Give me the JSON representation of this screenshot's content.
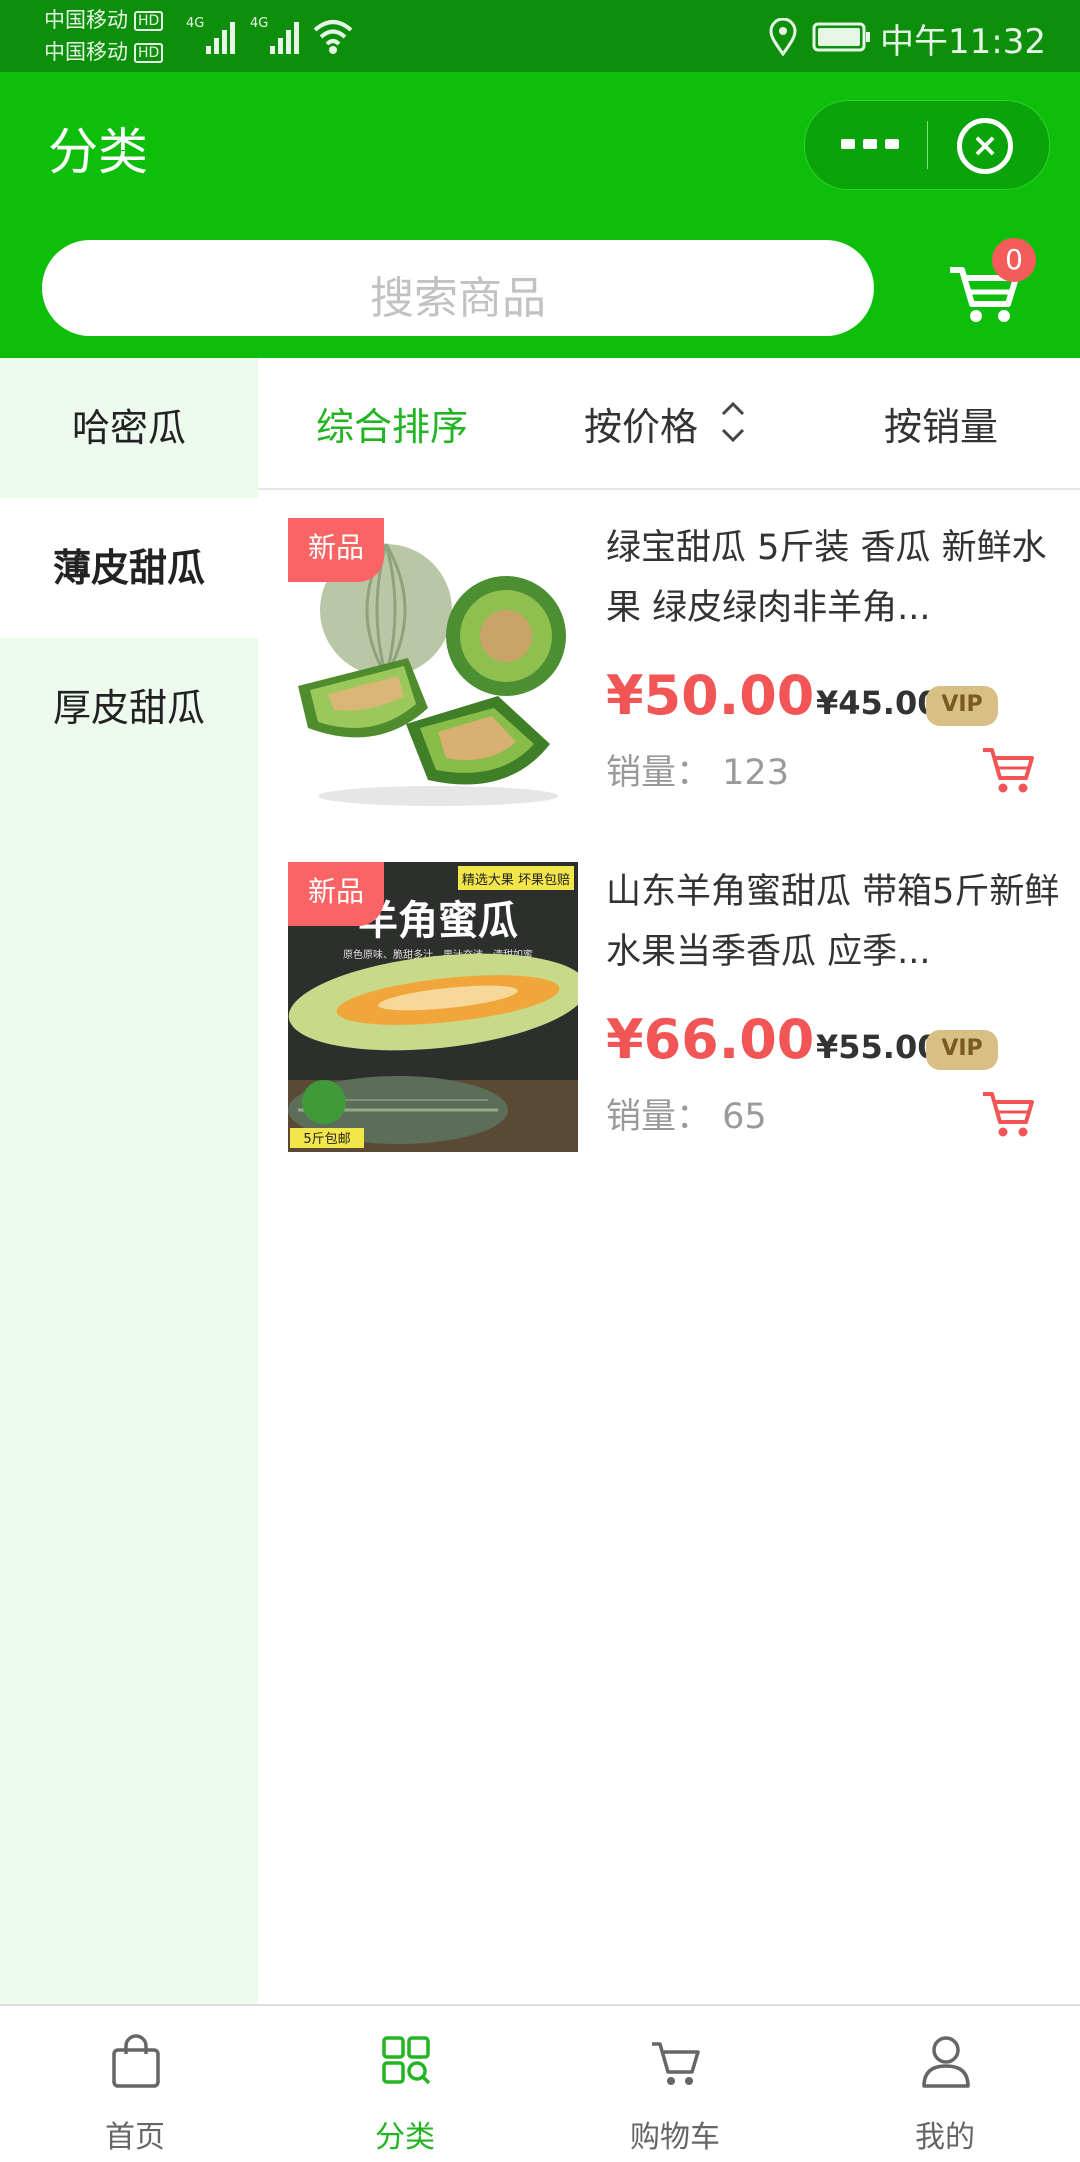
{
  "status_bar": {
    "carrier1": "中国移动",
    "carrier2": "中国移动",
    "hd": "HD",
    "network": "4G",
    "time": "中午11:32"
  },
  "nav": {
    "title": "分类",
    "more_icon": "more-dots-icon",
    "close_icon": "close-circle-icon"
  },
  "search": {
    "placeholder": "搜索商品"
  },
  "cart": {
    "count": "0"
  },
  "sidebar": {
    "items": [
      {
        "label": "哈密瓜",
        "active": false
      },
      {
        "label": "薄皮甜瓜",
        "active": true
      },
      {
        "label": "厚皮甜瓜",
        "active": false
      }
    ]
  },
  "sort": {
    "comprehensive": "综合排序",
    "price": "按价格",
    "sales": "按销量"
  },
  "products": [
    {
      "tag": "新品",
      "title": "绿宝甜瓜 5斤装 香瓜 新鲜水果 绿皮绿肉非羊角...",
      "price": "¥50.00",
      "vip_price": "¥45.00",
      "vip_label": "VIP",
      "sales_label": "销量：",
      "sales_count": "123"
    },
    {
      "tag": "新品",
      "title": "山东羊角蜜甜瓜 带箱5斤新鲜水果当季香瓜 应季...",
      "price": "¥66.00",
      "vip_price": "¥55.00",
      "vip_label": "VIP",
      "sales_label": "销量：",
      "sales_count": "65",
      "image_text": {
        "heading": "羊角蜜瓜",
        "banner": "精选大果 坏果包赔",
        "sub": "原色原味、脆甜多汁、果汁充沛、清甜如蜜",
        "shipping": "5斤包邮"
      }
    }
  ],
  "tabbar": [
    {
      "label": "首页",
      "icon": "home-bag-icon",
      "active": false
    },
    {
      "label": "分类",
      "icon": "category-grid-icon",
      "active": true
    },
    {
      "label": "购物车",
      "icon": "cart-icon",
      "active": false
    },
    {
      "label": "我的",
      "icon": "user-icon",
      "active": false
    }
  ],
  "colors": {
    "brand_green": "#0dbf0b",
    "status_green": "#0e8f0c",
    "price_red": "#f15555",
    "active_green": "#22b422"
  }
}
